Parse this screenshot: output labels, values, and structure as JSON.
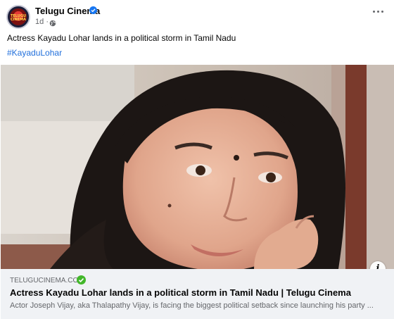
{
  "post": {
    "page_name": "Telugu Cinema",
    "avatar_text": "TELUGU CINEMA",
    "time": "1d",
    "time_separator": "·",
    "caption": "Actress Kayadu Lohar lands in a political storm in Tamil Nadu",
    "hashtag": "#KayaduLohar"
  },
  "link_card": {
    "domain": "TELUGUCINEMA.COM",
    "title": "Actress Kayadu Lohar lands in a political storm in Tamil Nadu | Telugu Cinema",
    "description": "Actor Joseph Vijay, aka Thalapathy Vijay, is facing the biggest political setback since launching his party ..."
  },
  "icons": {
    "verified": "verified-badge-icon",
    "globe": "globe-icon",
    "more": "more-options-icon",
    "info": "info-icon",
    "domain_verified": "check-circle-icon"
  },
  "colors": {
    "verified_blue": "#1877f2",
    "hashtag_blue": "#216fdb",
    "secondary_text": "#65676b",
    "card_background": "#f0f2f5",
    "check_green": "#42b72a"
  }
}
